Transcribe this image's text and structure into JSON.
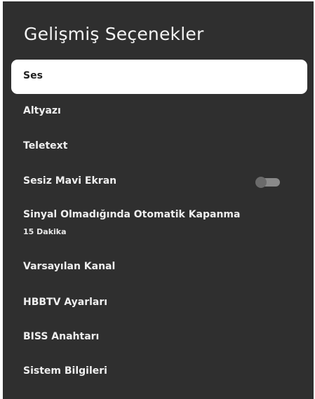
{
  "title": "Gelişmiş Seçenekler",
  "items": [
    {
      "label": "Ses"
    },
    {
      "label": "Altyazı"
    },
    {
      "label": "Teletext"
    },
    {
      "label": "Sesiz Mavi Ekran",
      "toggle": "off"
    },
    {
      "label": "Sinyal Olmadığında Otomatik Kapanma",
      "sublabel": "15 Dakika"
    },
    {
      "label": "Varsayılan Kanal"
    },
    {
      "label": "HBBTV Ayarları"
    },
    {
      "label": "BISS Anahtarı"
    },
    {
      "label": "Sistem Bilgileri"
    }
  ],
  "colors": {
    "background": "#2f2f2f",
    "selected_bg": "#ffffff",
    "text": "#efefef",
    "toggle_off_track": "#8a8a8a"
  }
}
